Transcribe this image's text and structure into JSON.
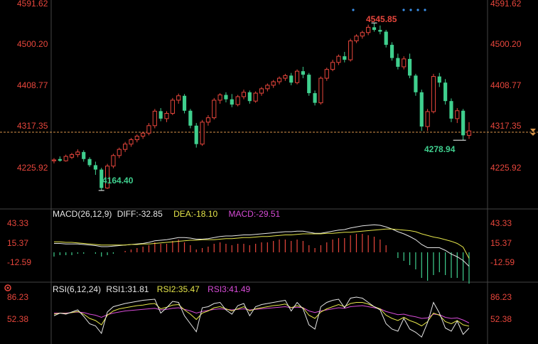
{
  "colors": {
    "up": "#e8463c",
    "down": "#3fcf8e",
    "grid": "#2a2a2a",
    "current": "#d8954a",
    "diff": "#e6e6e6",
    "dea": "#e6e64a",
    "rsi1": "#e6e6e6",
    "rsi2": "#e6e64a",
    "rsi3": "#d84cd8"
  },
  "price_axis": [
    "4591.62",
    "4500.20",
    "4408.77",
    "4317.35",
    "4225.92"
  ],
  "annotations": {
    "high": "4545.85",
    "low": "4164.40",
    "last_low": "4278.94"
  },
  "macd": {
    "title": "MACD(26,12,9)",
    "diff": "DIFF:-32.85",
    "dea": "DEA:-18.10",
    "macd": "MACD:-29.51",
    "axis": [
      "43.33",
      "15.37",
      "-12.59"
    ]
  },
  "rsi": {
    "title": "RSI(6,12,24)",
    "rsi1": "RSI1:31.81",
    "rsi2": "RSI2:35.47",
    "rsi3": "RSI3:41.49",
    "axis": [
      "86.23",
      "52.38"
    ]
  },
  "chart_data": {
    "type": "candlestick",
    "ylim": [
      4164.4,
      4591.62
    ],
    "current_price": 4297.0,
    "candles": [
      [
        4232,
        4238,
        4226,
        4234
      ],
      [
        4236,
        4242,
        4230,
        4232
      ],
      [
        4232,
        4246,
        4230,
        4242
      ],
      [
        4240,
        4250,
        4236,
        4246
      ],
      [
        4246,
        4258,
        4240,
        4252
      ],
      [
        4252,
        4256,
        4230,
        4236
      ],
      [
        4236,
        4240,
        4218,
        4222
      ],
      [
        4222,
        4230,
        4200,
        4212
      ],
      [
        4212,
        4216,
        4164,
        4170
      ],
      [
        4170,
        4225,
        4168,
        4220
      ],
      [
        4220,
        4248,
        4215,
        4244
      ],
      [
        4244,
        4262,
        4238,
        4258
      ],
      [
        4258,
        4275,
        4252,
        4270
      ],
      [
        4270,
        4284,
        4264,
        4280
      ],
      [
        4280,
        4292,
        4274,
        4288
      ],
      [
        4288,
        4298,
        4282,
        4295
      ],
      [
        4295,
        4318,
        4290,
        4312
      ],
      [
        4312,
        4350,
        4306,
        4345
      ],
      [
        4345,
        4352,
        4322,
        4328
      ],
      [
        4328,
        4345,
        4320,
        4340
      ],
      [
        4340,
        4375,
        4336,
        4370
      ],
      [
        4370,
        4385,
        4362,
        4380
      ],
      [
        4380,
        4384,
        4340,
        4346
      ],
      [
        4346,
        4350,
        4306,
        4312
      ],
      [
        4312,
        4318,
        4262,
        4270
      ],
      [
        4270,
        4325,
        4266,
        4320
      ],
      [
        4320,
        4336,
        4312,
        4330
      ],
      [
        4330,
        4375,
        4326,
        4370
      ],
      [
        4370,
        4386,
        4362,
        4382
      ],
      [
        4382,
        4388,
        4365,
        4372
      ],
      [
        4372,
        4384,
        4354,
        4360
      ],
      [
        4360,
        4382,
        4356,
        4378
      ],
      [
        4378,
        4394,
        4372,
        4388
      ],
      [
        4388,
        4392,
        4362,
        4368
      ],
      [
        4368,
        4390,
        4364,
        4386
      ],
      [
        4386,
        4400,
        4380,
        4396
      ],
      [
        4396,
        4408,
        4390,
        4404
      ],
      [
        4404,
        4416,
        4398,
        4412
      ],
      [
        4412,
        4424,
        4406,
        4420
      ],
      [
        4420,
        4430,
        4414,
        4426
      ],
      [
        4426,
        4432,
        4404,
        4410
      ],
      [
        4410,
        4440,
        4406,
        4436
      ],
      [
        4436,
        4446,
        4420,
        4428
      ],
      [
        4428,
        4432,
        4380,
        4386
      ],
      [
        4386,
        4392,
        4358,
        4364
      ],
      [
        4364,
        4424,
        4360,
        4420
      ],
      [
        4420,
        4444,
        4414,
        4440
      ],
      [
        4440,
        4462,
        4436,
        4456
      ],
      [
        4456,
        4474,
        4450,
        4470
      ],
      [
        4470,
        4480,
        4456,
        4462
      ],
      [
        4462,
        4510,
        4458,
        4505
      ],
      [
        4505,
        4520,
        4500,
        4516
      ],
      [
        4516,
        4528,
        4510,
        4524
      ],
      [
        4524,
        4542,
        4518,
        4536
      ],
      [
        4536,
        4545,
        4526,
        4530
      ],
      [
        4530,
        4540,
        4520,
        4526
      ],
      [
        4526,
        4530,
        4490,
        4496
      ],
      [
        4496,
        4502,
        4460,
        4466
      ],
      [
        4466,
        4476,
        4440,
        4446
      ],
      [
        4446,
        4470,
        4440,
        4464
      ],
      [
        4464,
        4476,
        4420,
        4426
      ],
      [
        4426,
        4430,
        4380,
        4388
      ],
      [
        4388,
        4394,
        4300,
        4310
      ],
      [
        4310,
        4350,
        4300,
        4344
      ],
      [
        4344,
        4430,
        4340,
        4424
      ],
      [
        4424,
        4432,
        4400,
        4410
      ],
      [
        4410,
        4418,
        4360,
        4368
      ],
      [
        4368,
        4374,
        4320,
        4328
      ],
      [
        4328,
        4352,
        4318,
        4346
      ],
      [
        4346,
        4350,
        4278.94,
        4290
      ],
      [
        4290,
        4320,
        4282,
        4300
      ]
    ],
    "macd_bars": [
      -3,
      -2,
      -2,
      -2,
      -1,
      -1,
      0,
      -1,
      -3,
      -2,
      -1,
      0,
      1,
      2,
      3,
      4,
      5,
      7,
      6,
      6,
      8,
      9,
      7,
      5,
      2,
      3,
      4,
      6,
      7,
      6,
      5,
      6,
      6,
      5,
      6,
      7,
      7,
      8,
      9,
      9,
      8,
      9,
      8,
      5,
      3,
      5,
      7,
      9,
      10,
      10,
      12,
      13,
      13,
      12,
      11,
      9,
      5,
      0,
      -4,
      -6,
      -9,
      -12,
      -18,
      -20,
      -16,
      -14,
      -16,
      -18,
      -18,
      -20,
      -22
    ],
    "diff": [
      10,
      10,
      9,
      9,
      9,
      8,
      7,
      6,
      4,
      4,
      5,
      6,
      7,
      8,
      9,
      10,
      12,
      15,
      16,
      17,
      19,
      21,
      21,
      20,
      18,
      18,
      19,
      21,
      23,
      24,
      24,
      25,
      26,
      26,
      27,
      28,
      29,
      30,
      31,
      32,
      32,
      33,
      33,
      31,
      29,
      29,
      31,
      33,
      35,
      36,
      39,
      41,
      43,
      44,
      45,
      44,
      41,
      37,
      32,
      28,
      23,
      17,
      8,
      2,
      2,
      2,
      -3,
      -10,
      -15,
      -22,
      -32.85
    ],
    "dea": [
      13,
      13,
      12,
      12,
      11,
      10,
      9,
      8,
      7,
      7,
      7,
      7,
      7,
      8,
      8,
      9,
      9,
      10,
      11,
      12,
      13,
      14,
      15,
      16,
      16,
      17,
      17,
      17,
      18,
      19,
      19,
      20,
      21,
      21,
      22,
      23,
      23,
      24,
      25,
      26,
      26,
      27,
      28,
      28,
      28,
      28,
      29,
      29,
      30,
      31,
      31,
      32,
      33,
      34,
      35,
      36,
      37,
      37,
      36,
      35,
      34,
      32,
      28,
      25,
      22,
      20,
      17,
      14,
      10,
      3,
      -18.1
    ],
    "rsi1": [
      55,
      60,
      58,
      62,
      66,
      54,
      40,
      36,
      22,
      62,
      72,
      75,
      78,
      80,
      82,
      84,
      85,
      86,
      60,
      70,
      82,
      80,
      55,
      40,
      25,
      70,
      72,
      78,
      80,
      66,
      58,
      74,
      78,
      55,
      72,
      76,
      78,
      80,
      82,
      84,
      64,
      80,
      68,
      38,
      30,
      72,
      80,
      84,
      86,
      70,
      88,
      90,
      88,
      80,
      72,
      66,
      40,
      30,
      26,
      50,
      30,
      24,
      15,
      42,
      80,
      60,
      32,
      26,
      45,
      20,
      31.81
    ],
    "rsi2": [
      58,
      60,
      59,
      61,
      63,
      58,
      50,
      46,
      38,
      56,
      64,
      68,
      70,
      72,
      74,
      75,
      77,
      78,
      68,
      71,
      75,
      76,
      66,
      58,
      48,
      60,
      64,
      70,
      72,
      68,
      64,
      68,
      72,
      64,
      68,
      70,
      72,
      74,
      75,
      77,
      70,
      74,
      70,
      56,
      50,
      62,
      68,
      72,
      76,
      72,
      78,
      80,
      80,
      77,
      72,
      68,
      56,
      50,
      46,
      52,
      46,
      42,
      36,
      44,
      60,
      56,
      44,
      40,
      46,
      38,
      35.47
    ],
    "rsi3": [
      60,
      60,
      60,
      61,
      62,
      61,
      58,
      56,
      52,
      57,
      60,
      62,
      64,
      65,
      66,
      67,
      68,
      69,
      66,
      67,
      69,
      70,
      67,
      64,
      60,
      63,
      65,
      67,
      68,
      67,
      66,
      67,
      68,
      66,
      67,
      68,
      69,
      70,
      71,
      72,
      70,
      71,
      70,
      64,
      61,
      64,
      66,
      68,
      70,
      69,
      72,
      73,
      74,
      72,
      70,
      68,
      63,
      60,
      57,
      58,
      55,
      53,
      50,
      51,
      58,
      57,
      52,
      50,
      51,
      47,
      41.49
    ]
  }
}
